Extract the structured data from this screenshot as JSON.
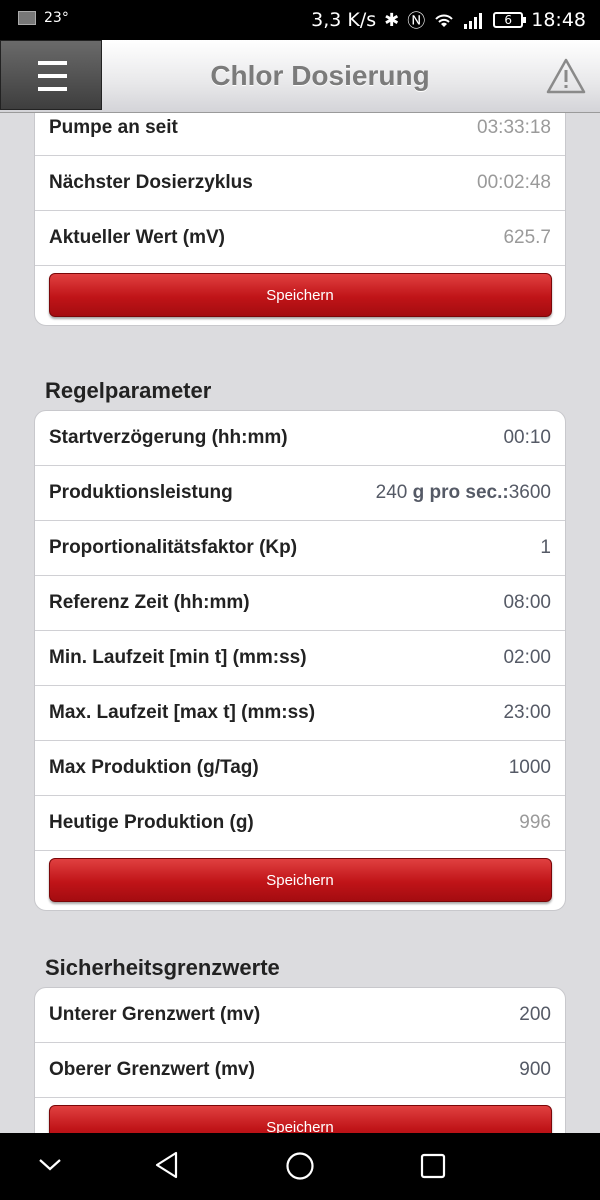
{
  "status_bar": {
    "temperature": "23°",
    "speed": "3,3 K/s",
    "battery": "6",
    "time": "18:48"
  },
  "header": {
    "title": "Chlor Dosierung"
  },
  "pump_section": {
    "rows": [
      {
        "label": "Pumpe an seit",
        "value": "03:33:18"
      },
      {
        "label": "Nächster Dosierzyklus",
        "value": "00:02:48"
      },
      {
        "label": "Aktueller Wert (mV)",
        "value": "625.7"
      }
    ],
    "save_label": "Speichern"
  },
  "regelparameter": {
    "title": "Regelparameter",
    "rows": [
      {
        "label": "Startverzögerung (hh:mm)",
        "value": "00:10"
      },
      {
        "label": "Produktionsleistung",
        "value_prefix": "240",
        "value_unit": "g pro sec.:",
        "value": "3600"
      },
      {
        "label": "Proportionalitätsfaktor (Kp)",
        "value": "1"
      },
      {
        "label": "Referenz Zeit (hh:mm)",
        "value": "08:00"
      },
      {
        "label": "Min. Laufzeit [min t] (mm:ss)",
        "value": "02:00"
      },
      {
        "label": "Max. Laufzeit [max t] (mm:ss)",
        "value": "23:00"
      },
      {
        "label": "Max Produktion (g/Tag)",
        "value": "1000"
      },
      {
        "label": "Heutige Produktion (g)",
        "value": "996"
      }
    ],
    "save_label": "Speichern"
  },
  "sicherheitsgrenzwerte": {
    "title": "Sicherheitsgrenzwerte",
    "rows": [
      {
        "label": "Unterer Grenzwert (mv)",
        "value": "200"
      },
      {
        "label": "Oberer Grenzwert (mv)",
        "value": "900"
      }
    ],
    "save_label": "Speichern"
  },
  "colors": {
    "accent_red": "#c01418",
    "header_title": "#7b7b7b",
    "background": "#dcdcdf"
  },
  "icons": {
    "menu": "hamburger-icon",
    "warning": "warning-icon",
    "nav": [
      "chevron-down-icon",
      "back-icon",
      "home-icon",
      "recents-icon"
    ]
  }
}
